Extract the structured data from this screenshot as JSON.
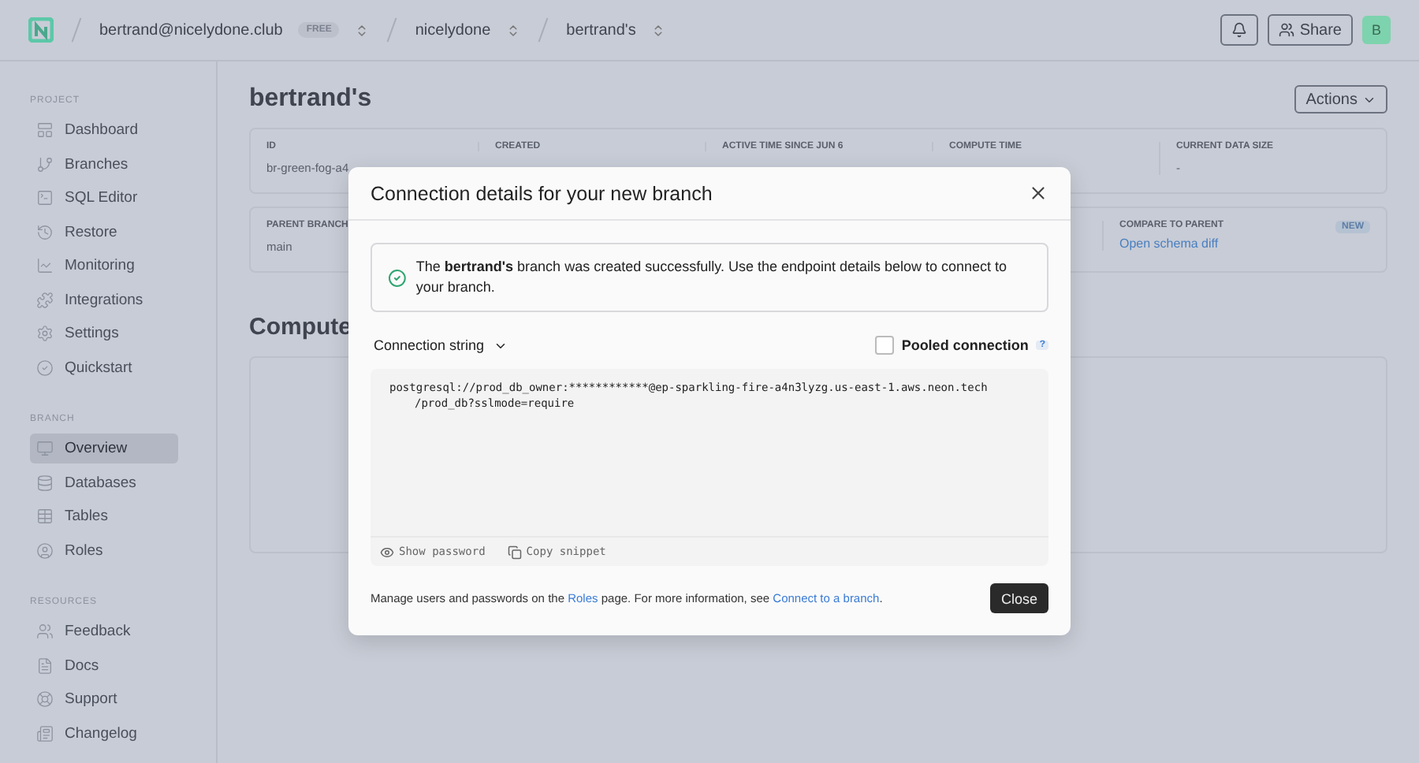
{
  "topbar": {
    "breadcrumbs": [
      {
        "label": "bertrand@nicelydone.club",
        "badge": "FREE"
      },
      {
        "label": "nicelydone"
      },
      {
        "label": "bertrand's"
      }
    ],
    "share": "Share",
    "avatar": "B"
  },
  "sidebar": {
    "sections": [
      {
        "title": "PROJECT",
        "items": [
          {
            "label": "Dashboard",
            "selected": false
          },
          {
            "label": "Branches",
            "selected": false
          },
          {
            "label": "SQL Editor",
            "selected": false
          },
          {
            "label": "Restore",
            "selected": false
          },
          {
            "label": "Monitoring",
            "selected": false
          },
          {
            "label": "Integrations",
            "selected": false
          },
          {
            "label": "Settings",
            "selected": false
          },
          {
            "label": "Quickstart",
            "selected": false
          }
        ]
      },
      {
        "title": "BRANCH",
        "items": [
          {
            "label": "Overview",
            "selected": true
          },
          {
            "label": "Databases",
            "selected": false
          },
          {
            "label": "Tables",
            "selected": false
          },
          {
            "label": "Roles",
            "selected": false
          }
        ]
      },
      {
        "title": "RESOURCES",
        "items": [
          {
            "label": "Feedback",
            "selected": false
          },
          {
            "label": "Docs",
            "selected": false
          },
          {
            "label": "Support",
            "selected": false
          },
          {
            "label": "Changelog",
            "selected": false
          }
        ]
      }
    ]
  },
  "main": {
    "title": "bertrand's",
    "actions": "Actions",
    "stats": [
      {
        "label": "ID",
        "value": "br-green-fog-a4"
      },
      {
        "label": "CREATED"
      },
      {
        "label": "ACTIVE TIME SINCE JUN 6"
      },
      {
        "label": "COMPUTE TIME"
      },
      {
        "label": "CURRENT DATA SIZE",
        "value": "-"
      }
    ],
    "details": {
      "parent": {
        "label": "PARENT BRANCH",
        "value": "main"
      },
      "compare": {
        "label": "COMPARE TO PARENT",
        "link": "Open schema diff",
        "badge": "NEW"
      }
    },
    "computes_title": "Compute"
  },
  "dialog": {
    "title": "Connection details for your new branch",
    "alert": "The **bertrand's** branch was created successfully. Use the endpoint details below to connect to your branch.",
    "select": "Connection string",
    "pooled": {
      "label": "Pooled connection",
      "checked": false,
      "help": "?"
    },
    "code_lines": [
      "postgresql://prod_db_owner:************@ep-sparkling-fire-a4n3lyzg.us-east-1.aws.neon.tech",
      "/prod_db?sslmode=require"
    ],
    "show_password": "Show password",
    "copy_snippet": "Copy snippet",
    "footer": [
      {
        "kind": "text",
        "text": "Manage users and passwords on the "
      },
      {
        "kind": "link",
        "text": "Roles"
      },
      {
        "kind": "text",
        "text": " page. For more information, see "
      },
      {
        "kind": "link",
        "text": "Connect to a branch"
      },
      {
        "kind": "text",
        "text": "."
      }
    ],
    "close": "Close"
  }
}
